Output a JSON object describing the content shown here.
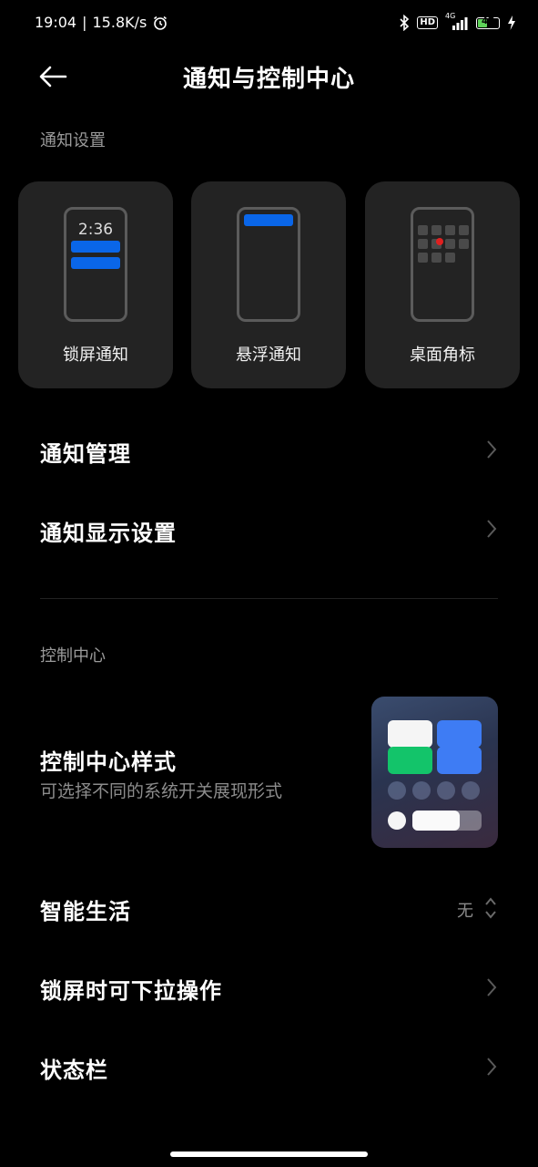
{
  "status_bar": {
    "time": "19:04",
    "separator": "|",
    "speed": "15.8K/s",
    "hd": "HD",
    "network": "4G",
    "battery": "47",
    "battery_level": 0.47
  },
  "header": {
    "title": "通知与控制中心"
  },
  "notification_section": {
    "label": "通知设置",
    "cards": [
      {
        "label": "锁屏通知",
        "clock": "2:36"
      },
      {
        "label": "悬浮通知"
      },
      {
        "label": "桌面角标"
      }
    ]
  },
  "rows": {
    "notification_management": "通知管理",
    "notification_display": "通知显示设置",
    "smart_life": "智能生活",
    "smart_life_value": "无",
    "lockscreen_pulldown": "锁屏时可下拉操作",
    "status_bar": "状态栏"
  },
  "control_center_section": {
    "label": "控制中心",
    "style_title": "控制中心样式",
    "style_subtitle": "可选择不同的系统开关展现形式"
  },
  "colors": {
    "accent_blue": "#0a66e8",
    "tile_blue": "#3e7cf4",
    "tile_green": "#13c46a",
    "background": "#000000",
    "card_bg": "#232323"
  }
}
